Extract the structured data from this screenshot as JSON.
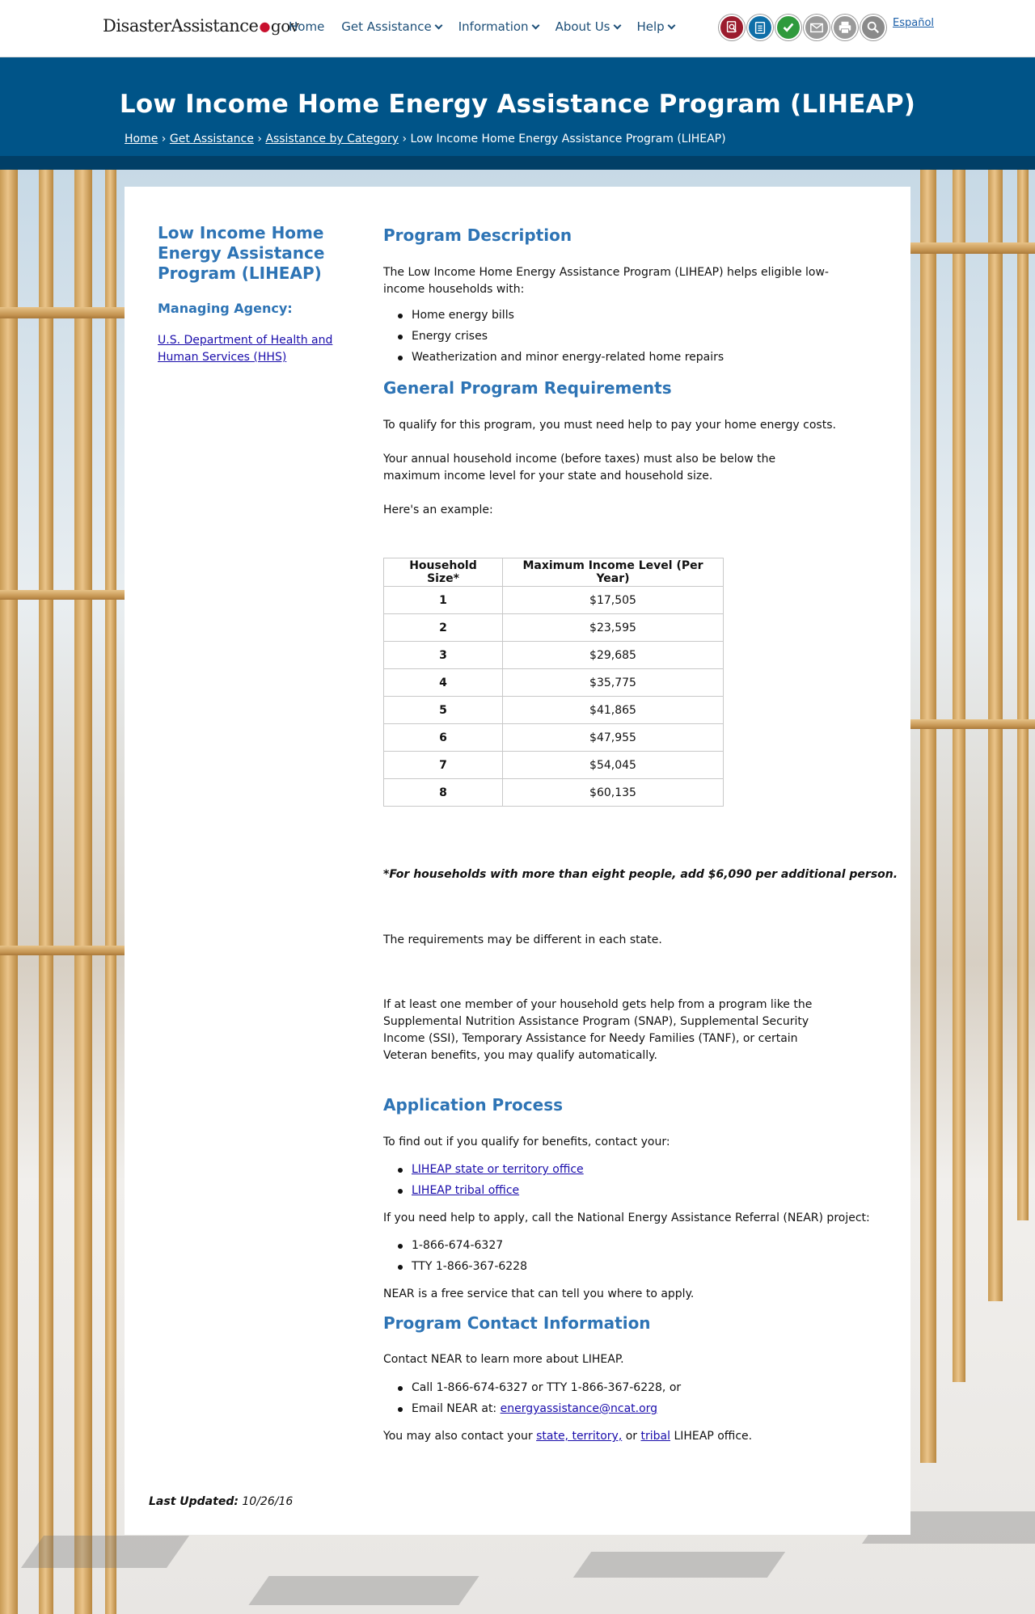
{
  "site": {
    "logo_left": "Disaster",
    "logo_mid": "Assistance",
    "logo_gov": "gov",
    "nav": {
      "home": "Home",
      "get_assistance": "Get Assistance",
      "information": "Information",
      "about_us": "About Us",
      "help": "Help"
    },
    "espanol": "Español",
    "tool_colors": {
      "find_assistance": "#9b1c2e",
      "checklist": "#0f6fa8",
      "check_status": "#2f9a3c",
      "email": "#9a9a9a",
      "print": "#9a9a9a",
      "search": "#8a8a8a"
    }
  },
  "header": {
    "title": "Low Income Home Energy Assistance Program (LIHEAP)",
    "breadcrumb": {
      "home": "Home",
      "get_assistance": "Get Assistance",
      "category": "Assistance by Category",
      "current": "Low Income Home Energy Assistance Program (LIHEAP)",
      "sep": "›"
    }
  },
  "sidebar": {
    "title": "Low Income Home Energy Assistance Program (LIHEAP)",
    "agency_label": "Managing Agency:",
    "agency_link": "U.S. Department of Health and Human Services (HHS)"
  },
  "content": {
    "desc_heading": "Program Description",
    "desc_intro": "The Low Income Home Energy Assistance Program (LIHEAP) helps eligible low-income households with:",
    "desc_items": [
      "Home energy bills",
      "Energy crises",
      "Weatherization and minor energy-related home repairs"
    ],
    "req_heading": "General Program Requirements",
    "req_p1": "To qualify for this program, you must need help to pay your home energy costs.",
    "req_p2": "Your annual household income (before taxes) must also be below the maximum income level for your state and household size.",
    "req_p3": "Here's an example:",
    "table": {
      "col1": "Household Size*",
      "col2": "Maximum Income Level (Per Year)",
      "rows": [
        {
          "size": "1",
          "income": "$17,505"
        },
        {
          "size": "2",
          "income": "$23,595"
        },
        {
          "size": "3",
          "income": "$29,685"
        },
        {
          "size": "4",
          "income": "$35,775"
        },
        {
          "size": "5",
          "income": "$41,865"
        },
        {
          "size": "6",
          "income": "$47,955"
        },
        {
          "size": "7",
          "income": "$54,045"
        },
        {
          "size": "8",
          "income": "$60,135"
        }
      ]
    },
    "note": "*For households with more than eight people, add $6,090 per additional person.",
    "req_p4": "The requirements may be different in each state.",
    "req_p5": "If at least one member of your household gets help from a program like the Supplemental Nutrition Assistance Program (SNAP), Supplemental Security Income (SSI), Temporary Assistance for Needy Families (TANF), or certain Veteran benefits, you may qualify automatically.",
    "app_heading": "Application Process",
    "app_p1": "To find out if you qualify for benefits, contact your:",
    "app_links": [
      "LIHEAP state or territory office",
      "LIHEAP tribal office"
    ],
    "app_p2": "If you need help to apply, call the National Energy Assistance Referral (NEAR) project:",
    "app_phones": [
      "1-866-674-6327",
      "TTY 1-866-367-6228"
    ],
    "app_p3": "NEAR is a free service that can tell you where to apply.",
    "contact_heading": "Program Contact Information",
    "contact_p1": "Contact NEAR to learn more about LIHEAP.",
    "contact_call": "Call 1-866-674-6327 or TTY 1-866-367-6228, or",
    "contact_email_prefix": "Email NEAR at: ",
    "contact_email": "energyassistance@ncat.org",
    "contact_also_prefix": "You may also contact your ",
    "contact_state_link": "state, territory,",
    "contact_or": " or ",
    "contact_tribal_link": "tribal",
    "contact_also_suffix": " LIHEAP office."
  },
  "footer": {
    "updated_label": "Last Updated:",
    "updated_date": "10/26/16"
  }
}
